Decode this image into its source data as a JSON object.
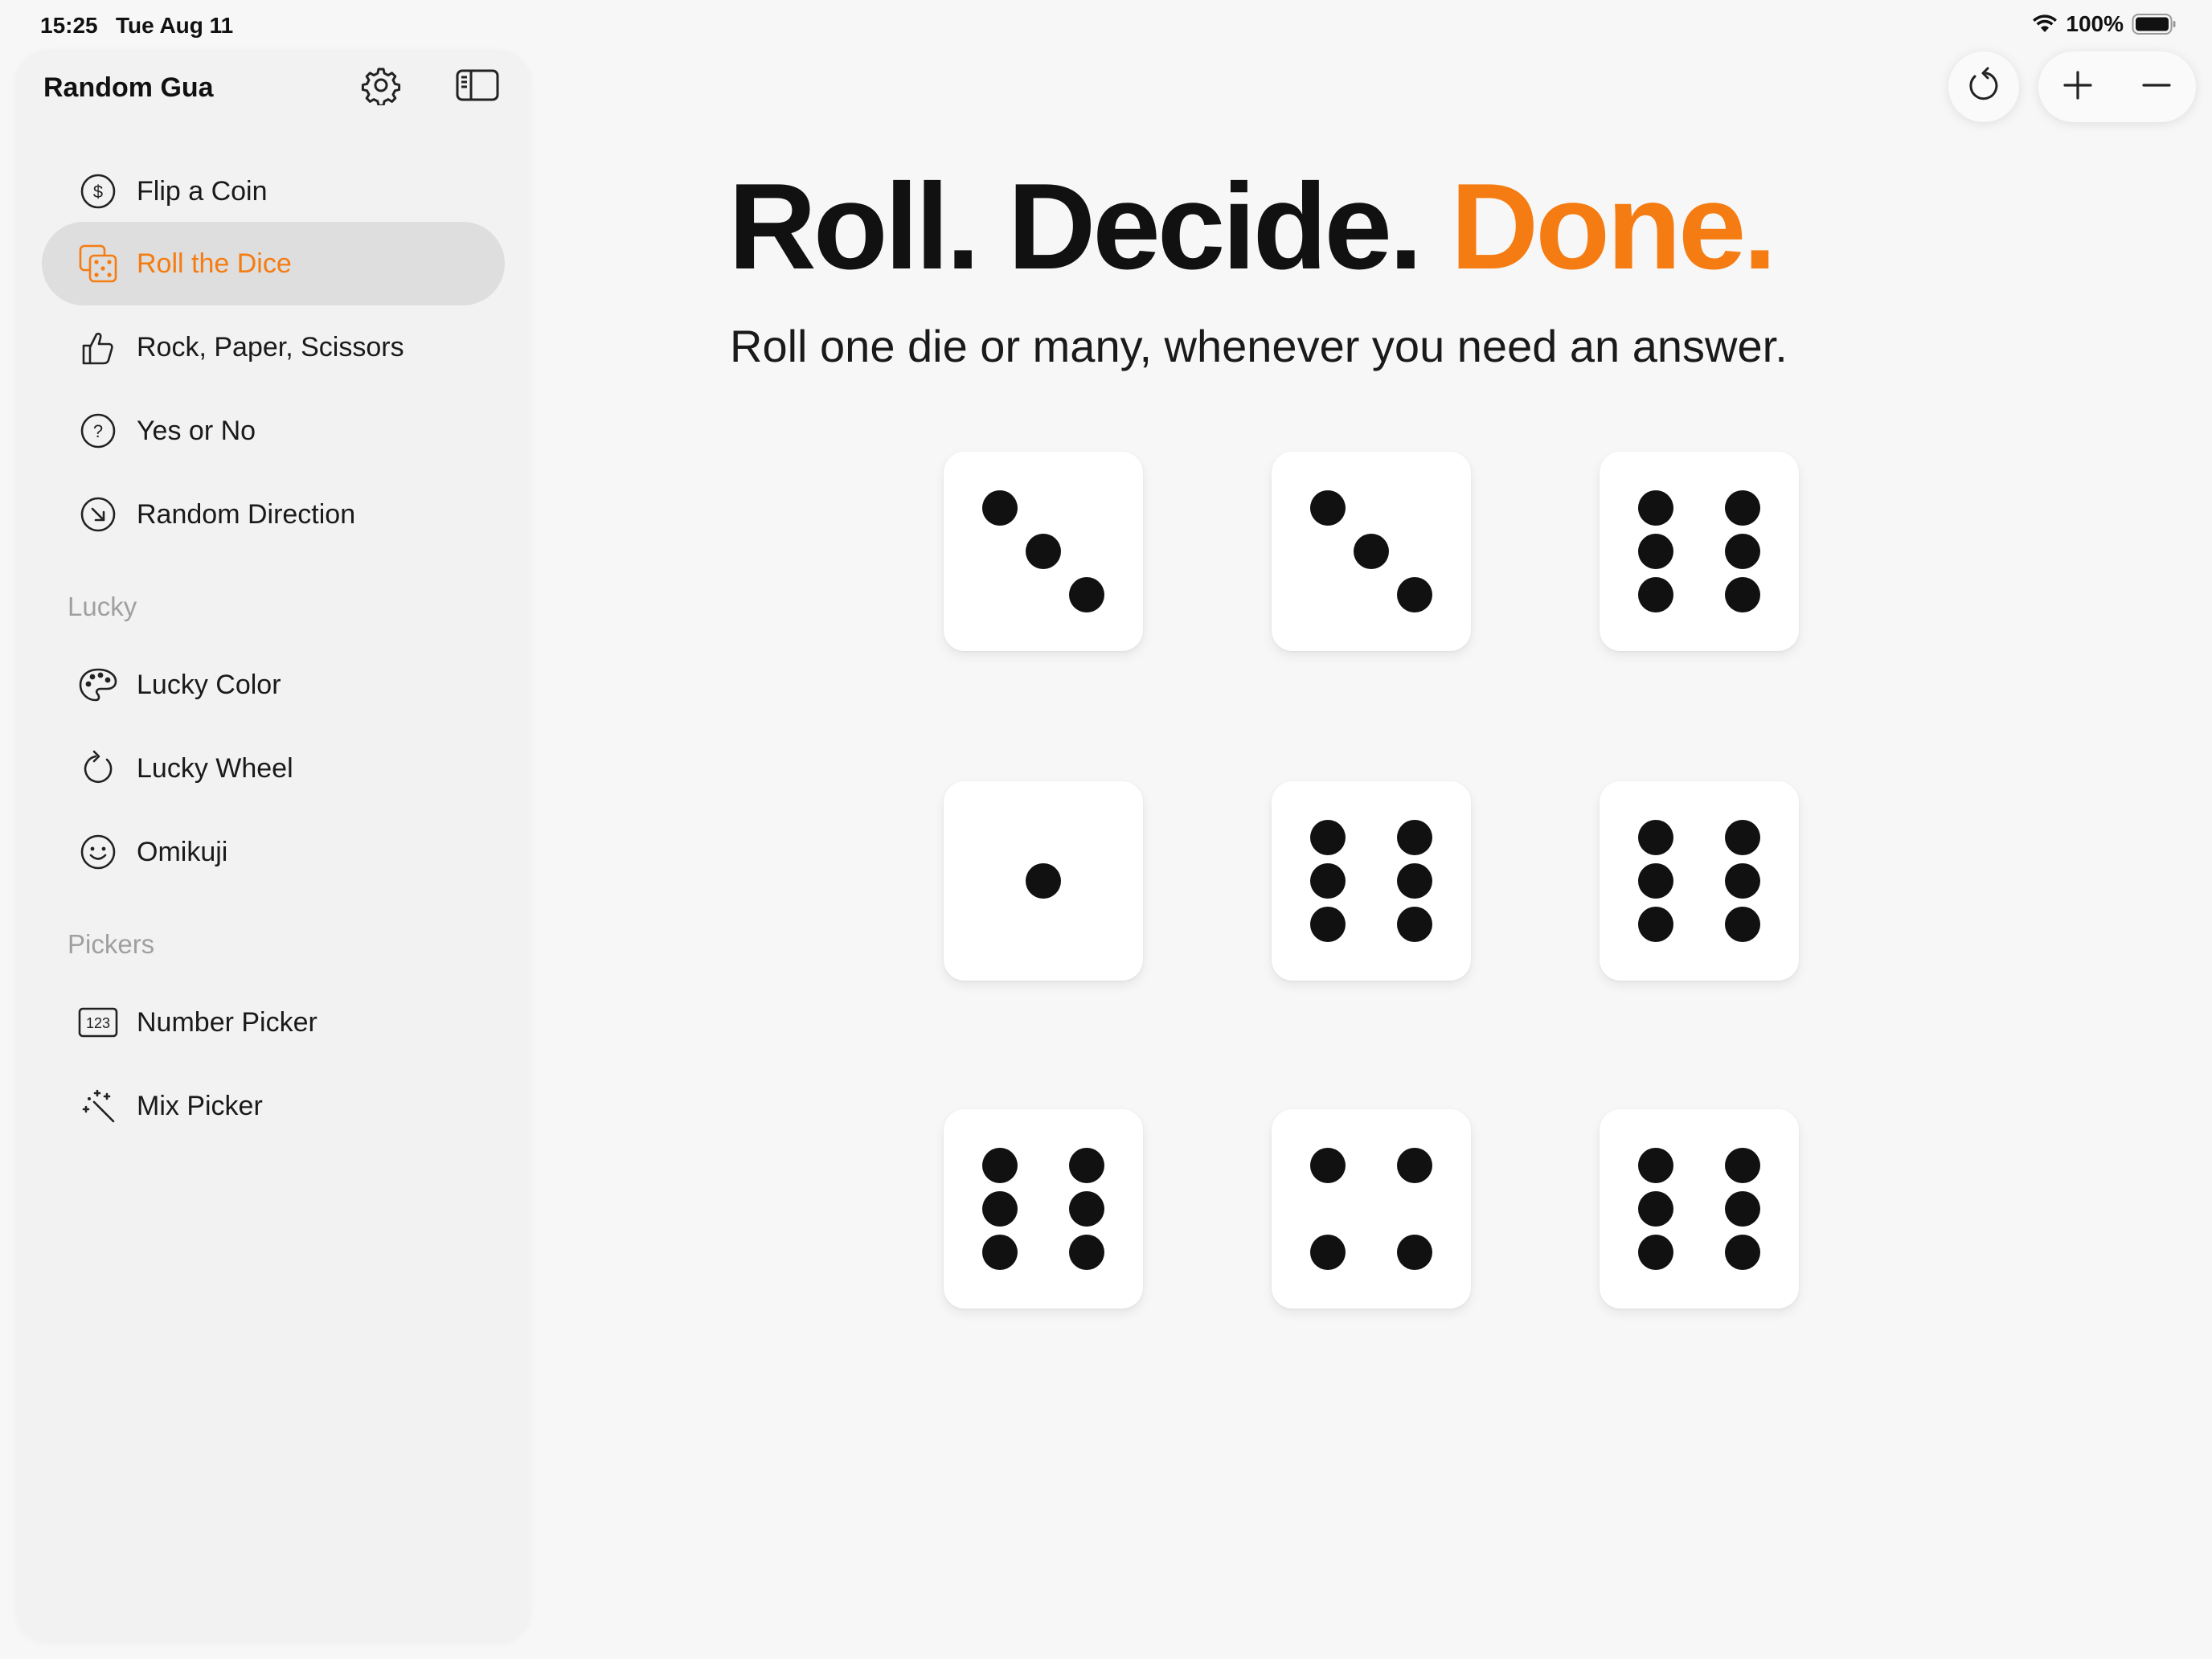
{
  "status_bar": {
    "time": "15:25",
    "date": "Tue Aug 11",
    "battery": "100%"
  },
  "sidebar": {
    "title": "Random Gua",
    "accent_color": "#f57c12",
    "items": [
      {
        "label": "Flip a Coin",
        "icon": "dollar-circle-icon",
        "active": false
      },
      {
        "label": "Roll the Dice",
        "icon": "dice-icon",
        "active": true
      },
      {
        "label": "Rock, Paper, Scissors",
        "icon": "hand-thumb-icon",
        "active": false
      },
      {
        "label": "Yes or No",
        "icon": "question-circle-icon",
        "active": false
      },
      {
        "label": "Random Direction",
        "icon": "arrow-circle-icon",
        "active": false
      }
    ],
    "sections": [
      {
        "title": "Lucky",
        "items": [
          {
            "label": "Lucky Color",
            "icon": "palette-icon"
          },
          {
            "label": "Lucky Wheel",
            "icon": "rotate-icon"
          },
          {
            "label": "Omikuji",
            "icon": "smiley-icon"
          }
        ]
      },
      {
        "title": "Pickers",
        "items": [
          {
            "label": "Number Picker",
            "icon": "number-123-icon"
          },
          {
            "label": "Mix Picker",
            "icon": "magic-wand-icon"
          }
        ]
      }
    ]
  },
  "hero": {
    "title_part1": "Roll. Decide. ",
    "title_part2": "Done.",
    "subtitle": "Roll one die or many, whenever you need an answer."
  },
  "dice": [
    3,
    3,
    6,
    1,
    6,
    6,
    6,
    4,
    6
  ]
}
